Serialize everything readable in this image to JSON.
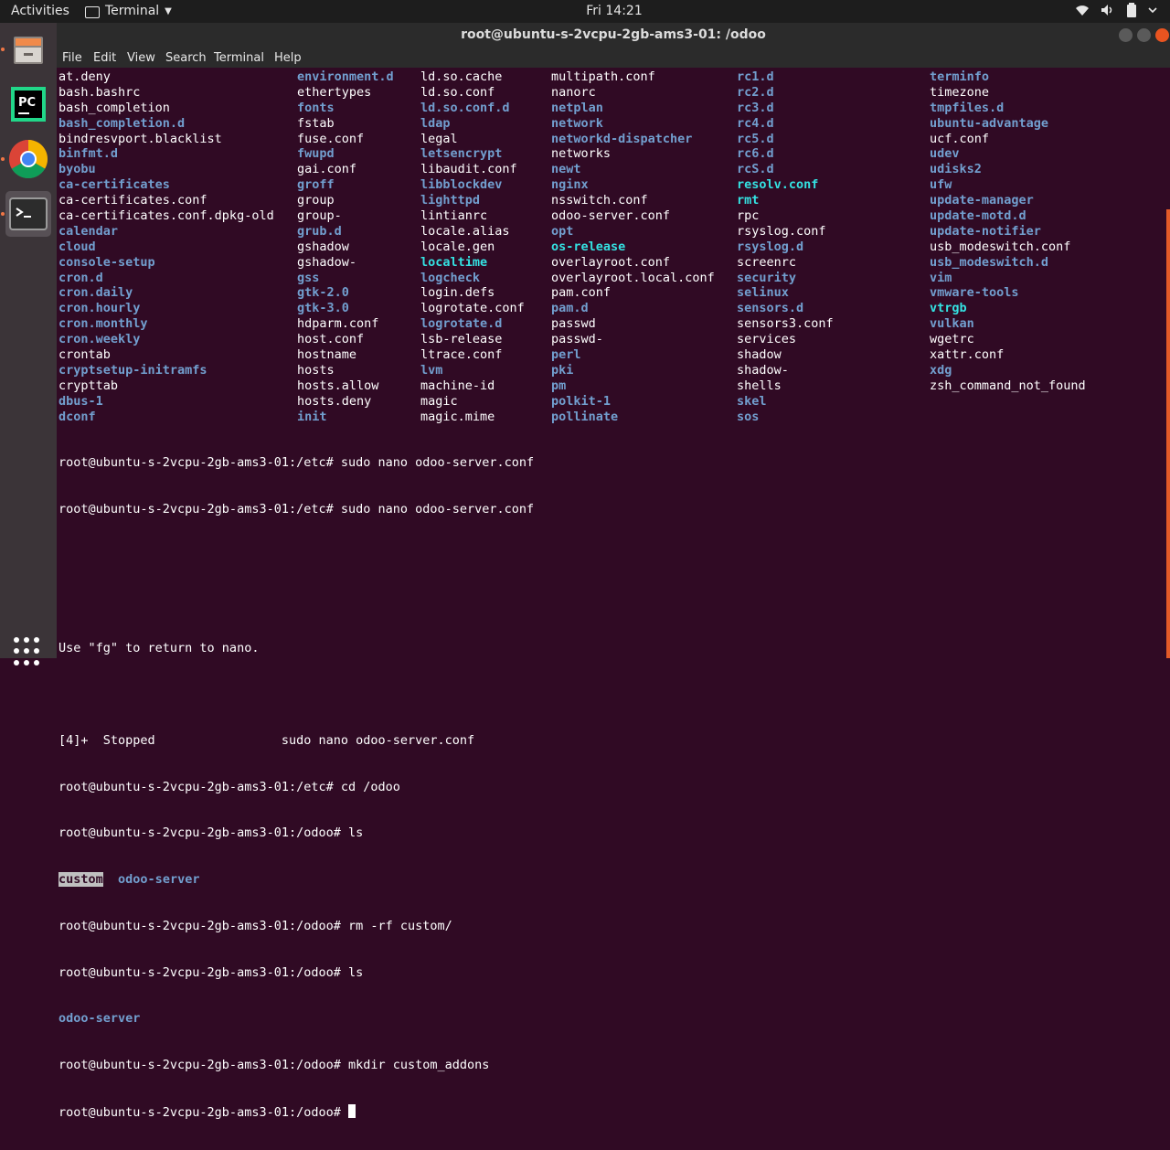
{
  "topbar": {
    "activities": "Activities",
    "app_name": "Terminal",
    "clock": "Fri 14:21"
  },
  "window": {
    "title": "root@ubuntu-s-2vcpu-2gb-ams3-01: /odoo",
    "menu": [
      "File",
      "Edit",
      "View",
      "Search",
      "Terminal",
      "Help"
    ]
  },
  "dock": {
    "apps": [
      "files-icon",
      "pycharm-icon",
      "chrome-icon",
      "terminal-icon"
    ],
    "pycharm_label": "PC"
  },
  "listing": {
    "columns": [
      [
        {
          "t": "at.deny",
          "c": "file"
        },
        {
          "t": "bash.bashrc",
          "c": "file"
        },
        {
          "t": "bash_completion",
          "c": "file"
        },
        {
          "t": "bash_completion.d",
          "c": "dir"
        },
        {
          "t": "bindresvport.blacklist",
          "c": "file"
        },
        {
          "t": "binfmt.d",
          "c": "dir"
        },
        {
          "t": "byobu",
          "c": "dir"
        },
        {
          "t": "ca-certificates",
          "c": "dir"
        },
        {
          "t": "ca-certificates.conf",
          "c": "file"
        },
        {
          "t": "ca-certificates.conf.dpkg-old",
          "c": "file"
        },
        {
          "t": "calendar",
          "c": "dir"
        },
        {
          "t": "cloud",
          "c": "dir"
        },
        {
          "t": "console-setup",
          "c": "dir"
        },
        {
          "t": "cron.d",
          "c": "dir"
        },
        {
          "t": "cron.daily",
          "c": "dir"
        },
        {
          "t": "cron.hourly",
          "c": "dir"
        },
        {
          "t": "cron.monthly",
          "c": "dir"
        },
        {
          "t": "cron.weekly",
          "c": "dir"
        },
        {
          "t": "crontab",
          "c": "file"
        },
        {
          "t": "cryptsetup-initramfs",
          "c": "dir"
        },
        {
          "t": "crypttab",
          "c": "file"
        },
        {
          "t": "dbus-1",
          "c": "dir"
        },
        {
          "t": "dconf",
          "c": "dir"
        }
      ],
      [
        {
          "t": "environment.d",
          "c": "dir"
        },
        {
          "t": "ethertypes",
          "c": "file"
        },
        {
          "t": "fonts",
          "c": "dir"
        },
        {
          "t": "fstab",
          "c": "file"
        },
        {
          "t": "fuse.conf",
          "c": "file"
        },
        {
          "t": "fwupd",
          "c": "dir"
        },
        {
          "t": "gai.conf",
          "c": "file"
        },
        {
          "t": "groff",
          "c": "dir"
        },
        {
          "t": "group",
          "c": "file"
        },
        {
          "t": "group-",
          "c": "file"
        },
        {
          "t": "grub.d",
          "c": "dir"
        },
        {
          "t": "gshadow",
          "c": "file"
        },
        {
          "t": "gshadow-",
          "c": "file"
        },
        {
          "t": "gss",
          "c": "dir"
        },
        {
          "t": "gtk-2.0",
          "c": "dir"
        },
        {
          "t": "gtk-3.0",
          "c": "dir"
        },
        {
          "t": "hdparm.conf",
          "c": "file"
        },
        {
          "t": "host.conf",
          "c": "file"
        },
        {
          "t": "hostname",
          "c": "file"
        },
        {
          "t": "hosts",
          "c": "file"
        },
        {
          "t": "hosts.allow",
          "c": "file"
        },
        {
          "t": "hosts.deny",
          "c": "file"
        },
        {
          "t": "init",
          "c": "dir"
        }
      ],
      [
        {
          "t": "ld.so.cache",
          "c": "file"
        },
        {
          "t": "ld.so.conf",
          "c": "file"
        },
        {
          "t": "ld.so.conf.d",
          "c": "dir"
        },
        {
          "t": "ldap",
          "c": "dir"
        },
        {
          "t": "legal",
          "c": "file"
        },
        {
          "t": "letsencrypt",
          "c": "dir"
        },
        {
          "t": "libaudit.conf",
          "c": "file"
        },
        {
          "t": "libblockdev",
          "c": "dir"
        },
        {
          "t": "lighttpd",
          "c": "dir"
        },
        {
          "t": "lintianrc",
          "c": "file"
        },
        {
          "t": "locale.alias",
          "c": "file"
        },
        {
          "t": "locale.gen",
          "c": "file"
        },
        {
          "t": "localtime",
          "c": "lnk"
        },
        {
          "t": "logcheck",
          "c": "dir"
        },
        {
          "t": "login.defs",
          "c": "file"
        },
        {
          "t": "logrotate.conf",
          "c": "file"
        },
        {
          "t": "logrotate.d",
          "c": "dir"
        },
        {
          "t": "lsb-release",
          "c": "file"
        },
        {
          "t": "ltrace.conf",
          "c": "file"
        },
        {
          "t": "lvm",
          "c": "dir"
        },
        {
          "t": "machine-id",
          "c": "file"
        },
        {
          "t": "magic",
          "c": "file"
        },
        {
          "t": "magic.mime",
          "c": "file"
        }
      ],
      [
        {
          "t": "multipath.conf",
          "c": "file"
        },
        {
          "t": "nanorc",
          "c": "file"
        },
        {
          "t": "netplan",
          "c": "dir"
        },
        {
          "t": "network",
          "c": "dir"
        },
        {
          "t": "networkd-dispatcher",
          "c": "dir"
        },
        {
          "t": "networks",
          "c": "file"
        },
        {
          "t": "newt",
          "c": "dir"
        },
        {
          "t": "nginx",
          "c": "dir"
        },
        {
          "t": "nsswitch.conf",
          "c": "file"
        },
        {
          "t": "odoo-server.conf",
          "c": "file"
        },
        {
          "t": "opt",
          "c": "dir"
        },
        {
          "t": "os-release",
          "c": "lnk"
        },
        {
          "t": "overlayroot.conf",
          "c": "file"
        },
        {
          "t": "overlayroot.local.conf",
          "c": "file"
        },
        {
          "t": "pam.conf",
          "c": "file"
        },
        {
          "t": "pam.d",
          "c": "dir"
        },
        {
          "t": "passwd",
          "c": "file"
        },
        {
          "t": "passwd-",
          "c": "file"
        },
        {
          "t": "perl",
          "c": "dir"
        },
        {
          "t": "pki",
          "c": "dir"
        },
        {
          "t": "pm",
          "c": "dir"
        },
        {
          "t": "polkit-1",
          "c": "dir"
        },
        {
          "t": "pollinate",
          "c": "dir"
        }
      ],
      [
        {
          "t": "rc1.d",
          "c": "dir"
        },
        {
          "t": "rc2.d",
          "c": "dir"
        },
        {
          "t": "rc3.d",
          "c": "dir"
        },
        {
          "t": "rc4.d",
          "c": "dir"
        },
        {
          "t": "rc5.d",
          "c": "dir"
        },
        {
          "t": "rc6.d",
          "c": "dir"
        },
        {
          "t": "rcS.d",
          "c": "dir"
        },
        {
          "t": "resolv.conf",
          "c": "lnk"
        },
        {
          "t": "rmt",
          "c": "lnk"
        },
        {
          "t": "rpc",
          "c": "file"
        },
        {
          "t": "rsyslog.conf",
          "c": "file"
        },
        {
          "t": "rsyslog.d",
          "c": "dir"
        },
        {
          "t": "screenrc",
          "c": "file"
        },
        {
          "t": "security",
          "c": "dir"
        },
        {
          "t": "selinux",
          "c": "dir"
        },
        {
          "t": "sensors.d",
          "c": "dir"
        },
        {
          "t": "sensors3.conf",
          "c": "file"
        },
        {
          "t": "services",
          "c": "file"
        },
        {
          "t": "shadow",
          "c": "file"
        },
        {
          "t": "shadow-",
          "c": "file"
        },
        {
          "t": "shells",
          "c": "file"
        },
        {
          "t": "skel",
          "c": "dir"
        },
        {
          "t": "sos",
          "c": "dir"
        }
      ],
      [
        {
          "t": "terminfo",
          "c": "dir"
        },
        {
          "t": "timezone",
          "c": "file"
        },
        {
          "t": "tmpfiles.d",
          "c": "dir"
        },
        {
          "t": "ubuntu-advantage",
          "c": "dir"
        },
        {
          "t": "ucf.conf",
          "c": "file"
        },
        {
          "t": "udev",
          "c": "dir"
        },
        {
          "t": "udisks2",
          "c": "dir"
        },
        {
          "t": "ufw",
          "c": "dir"
        },
        {
          "t": "update-manager",
          "c": "dir"
        },
        {
          "t": "update-motd.d",
          "c": "dir"
        },
        {
          "t": "update-notifier",
          "c": "dir"
        },
        {
          "t": "usb_modeswitch.conf",
          "c": "file"
        },
        {
          "t": "usb_modeswitch.d",
          "c": "dir"
        },
        {
          "t": "vim",
          "c": "dir"
        },
        {
          "t": "vmware-tools",
          "c": "dir"
        },
        {
          "t": "vtrgb",
          "c": "lnk"
        },
        {
          "t": "vulkan",
          "c": "dir"
        },
        {
          "t": "wgetrc",
          "c": "file"
        },
        {
          "t": "xattr.conf",
          "c": "file"
        },
        {
          "t": "xdg",
          "c": "dir"
        },
        {
          "t": "zsh_command_not_found",
          "c": "file"
        }
      ]
    ]
  },
  "tail": {
    "l1": "root@ubuntu-s-2vcpu-2gb-ams3-01:/etc# sudo nano odoo-server.conf",
    "l2": "root@ubuntu-s-2vcpu-2gb-ams3-01:/etc# sudo nano odoo-server.conf",
    "l3": "",
    "l4": "",
    "l5": "Use \"fg\" to return to nano.",
    "l6": "",
    "l7": "[4]+  Stopped                 sudo nano odoo-server.conf",
    "l8": "root@ubuntu-s-2vcpu-2gb-ams3-01:/etc# cd /odoo",
    "l9": "root@ubuntu-s-2vcpu-2gb-ams3-01:/odoo# ls",
    "l10_a": "custom",
    "l10_b": "odoo-server",
    "l11": "root@ubuntu-s-2vcpu-2gb-ams3-01:/odoo# rm -rf custom/",
    "l12": "root@ubuntu-s-2vcpu-2gb-ams3-01:/odoo# ls",
    "l13": "odoo-server",
    "l14": "root@ubuntu-s-2vcpu-2gb-ams3-01:/odoo# mkdir custom_addons",
    "l15": "root@ubuntu-s-2vcpu-2gb-ams3-01:/odoo# "
  }
}
